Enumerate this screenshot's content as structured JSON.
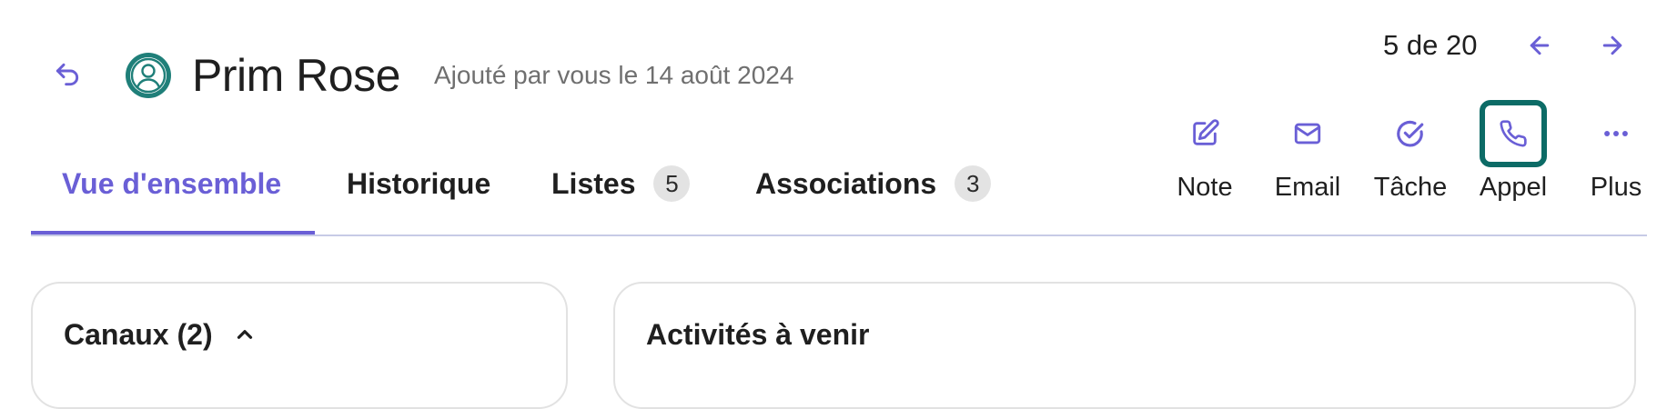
{
  "header": {
    "back_icon": "undo-arrow-icon",
    "avatar_icon": "user-circle-icon",
    "title": "Prim Rose",
    "subtitle": "Ajouté par vous le 14 août 2024",
    "pager": "5 de 20",
    "prev_icon": "arrow-left-icon",
    "next_icon": "arrow-right-icon"
  },
  "tabs": [
    {
      "label": "Vue d'ensemble",
      "active": true
    },
    {
      "label": "Historique"
    },
    {
      "label": "Listes",
      "badge": "5"
    },
    {
      "label": "Associations",
      "badge": "3"
    }
  ],
  "actions": [
    {
      "label": "Note",
      "icon": "edit-icon"
    },
    {
      "label": "Email",
      "icon": "mail-icon"
    },
    {
      "label": "Tâche",
      "icon": "check-circle-icon"
    },
    {
      "label": "Appel",
      "icon": "phone-icon",
      "focused": true
    },
    {
      "label": "Plus",
      "icon": "more-horizontal-icon"
    }
  ],
  "cards": {
    "channels": {
      "title": "Canaux (2)",
      "icon": "chevron-up-icon"
    },
    "upcoming": {
      "title": "Activités à venir"
    }
  },
  "colors": {
    "accent": "#6a5fd6",
    "focus_ring": "#0c6b66",
    "avatar": "#1f7f79",
    "badge_bg": "#e3e3e3",
    "divider": "#c7cbe6"
  }
}
